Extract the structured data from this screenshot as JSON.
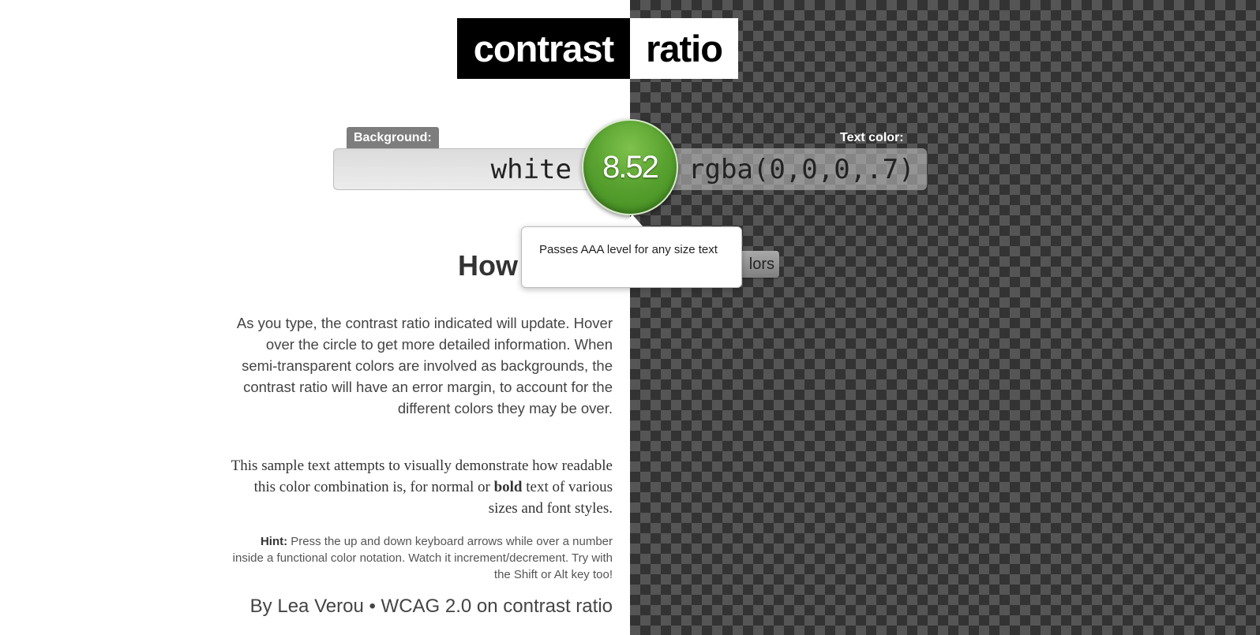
{
  "logo": {
    "word1": "contrast",
    "word2": "ratio"
  },
  "background": {
    "label": "Background:",
    "value": "white"
  },
  "text_color": {
    "label": "Text color:",
    "value": "rgba(0,0,0,.7)"
  },
  "ratio": {
    "value": "8.52",
    "color": "#5aa331"
  },
  "tooltip": {
    "text": "Passes AAA level for any size text"
  },
  "heading": {
    "text": "How",
    "swap_label": "lors"
  },
  "paragraphs": {
    "p1": "As you type, the contrast ratio indicated will update. Hover over the circle to get more detailed information. When semi-transparent colors are involved as backgrounds, the contrast ratio will have an error margin, to account for the different colors they may be over.",
    "p2_before": "This sample text attempts to visually demonstrate how readable this color combination is, for normal or ",
    "p2_bold": "bold",
    "p2_after": " text of various sizes and font styles.",
    "hint_label": "Hint:",
    "hint_text": " Press the up and down keyboard arrows while over a number inside a functional color notation. Watch it increment/decrement. Try with the Shift or Alt key too!"
  },
  "footer": {
    "by": "By ",
    "author": "Lea Verou",
    "separator": " • ",
    "wcag": "WCAG 2.0 on contrast ratio"
  }
}
